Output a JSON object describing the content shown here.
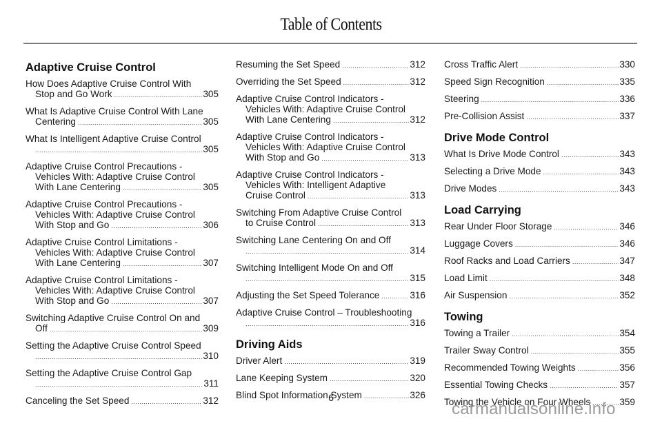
{
  "page": {
    "title": "Table of Contents",
    "page_number": "6",
    "watermark": "carmanualsonline.info"
  },
  "columns": [
    {
      "sections": [
        {
          "heading": "Adaptive Cruise Control",
          "entries": [
            {
              "lines": [
                "How Does Adaptive Cruise Control With",
                "Stop and Go Work"
              ],
              "page": "305"
            },
            {
              "lines": [
                "What Is Adaptive Cruise Control With Lane",
                "Centering"
              ],
              "page": "305"
            },
            {
              "lines": [
                "What Is Intelligent Adaptive Cruise Control",
                ""
              ],
              "page": "305"
            },
            {
              "lines": [
                "Adaptive Cruise Control Precautions -",
                "Vehicles With: Adaptive Cruise Control",
                "With Lane Centering"
              ],
              "page": "305"
            },
            {
              "lines": [
                "Adaptive Cruise Control Precautions -",
                "Vehicles With: Adaptive Cruise Control",
                "With Stop and Go"
              ],
              "page": "306"
            },
            {
              "lines": [
                "Adaptive Cruise Control Limitations -",
                "Vehicles With: Adaptive Cruise Control",
                "With Lane Centering"
              ],
              "page": "307"
            },
            {
              "lines": [
                "Adaptive Cruise Control Limitations -",
                "Vehicles With: Adaptive Cruise Control",
                "With Stop and Go"
              ],
              "page": "307"
            },
            {
              "lines": [
                "Switching Adaptive Cruise Control On and",
                "Off"
              ],
              "page": "309"
            },
            {
              "lines": [
                "Setting the Adaptive Cruise Control Speed",
                ""
              ],
              "page": "310"
            },
            {
              "lines": [
                "Setting the Adaptive Cruise Control Gap",
                ""
              ],
              "page": "311"
            },
            {
              "lines": [
                "Canceling the Set Speed"
              ],
              "page": "312"
            }
          ]
        }
      ]
    },
    {
      "sections": [
        {
          "heading": "",
          "entries": [
            {
              "lines": [
                "Resuming the Set Speed"
              ],
              "page": "312"
            },
            {
              "lines": [
                "Overriding the Set Speed"
              ],
              "page": "312"
            },
            {
              "lines": [
                "Adaptive Cruise Control Indicators -",
                "Vehicles With: Adaptive Cruise Control",
                "With Lane Centering"
              ],
              "page": "312"
            },
            {
              "lines": [
                "Adaptive Cruise Control Indicators -",
                "Vehicles With: Adaptive Cruise Control",
                "With Stop and Go"
              ],
              "page": "313"
            },
            {
              "lines": [
                "Adaptive Cruise Control Indicators -",
                "Vehicles With: Intelligent Adaptive",
                "Cruise Control"
              ],
              "page": "313"
            },
            {
              "lines": [
                "Switching From Adaptive Cruise Control",
                "to Cruise Control"
              ],
              "page": "313"
            },
            {
              "lines": [
                "Switching Lane Centering On and Off",
                ""
              ],
              "page": "314"
            },
            {
              "lines": [
                "Switching Intelligent Mode On and Off",
                ""
              ],
              "page": "315"
            },
            {
              "lines": [
                "Adjusting the Set Speed Tolerance"
              ],
              "page": "316"
            },
            {
              "lines": [
                "Adaptive Cruise Control – Troubleshooting",
                ""
              ],
              "page": "316"
            }
          ]
        },
        {
          "heading": "Driving Aids",
          "entries": [
            {
              "lines": [
                "Driver Alert"
              ],
              "page": "319"
            },
            {
              "lines": [
                "Lane Keeping System"
              ],
              "page": "320"
            },
            {
              "lines": [
                "Blind Spot Information System"
              ],
              "page": "326"
            }
          ]
        }
      ]
    },
    {
      "sections": [
        {
          "heading": "",
          "entries": [
            {
              "lines": [
                "Cross Traffic Alert"
              ],
              "page": "330"
            },
            {
              "lines": [
                "Speed Sign Recognition"
              ],
              "page": "335"
            },
            {
              "lines": [
                "Steering"
              ],
              "page": "336"
            },
            {
              "lines": [
                "Pre-Collision Assist"
              ],
              "page": "337"
            }
          ]
        },
        {
          "heading": "Drive Mode Control",
          "entries": [
            {
              "lines": [
                "What Is Drive Mode Control"
              ],
              "page": "343"
            },
            {
              "lines": [
                "Selecting a Drive Mode"
              ],
              "page": "343"
            },
            {
              "lines": [
                "Drive Modes"
              ],
              "page": "343"
            }
          ]
        },
        {
          "heading": "Load Carrying",
          "entries": [
            {
              "lines": [
                "Rear Under Floor Storage"
              ],
              "page": "346"
            },
            {
              "lines": [
                "Luggage Covers"
              ],
              "page": "346"
            },
            {
              "lines": [
                "Roof Racks and Load Carriers"
              ],
              "page": "347"
            },
            {
              "lines": [
                "Load Limit"
              ],
              "page": "348"
            },
            {
              "lines": [
                "Air Suspension"
              ],
              "page": "352"
            }
          ]
        },
        {
          "heading": "Towing",
          "entries": [
            {
              "lines": [
                "Towing a Trailer"
              ],
              "page": "354"
            },
            {
              "lines": [
                "Trailer Sway Control"
              ],
              "page": "355"
            },
            {
              "lines": [
                "Recommended Towing Weights"
              ],
              "page": "356"
            },
            {
              "lines": [
                "Essential Towing Checks"
              ],
              "page": "357"
            },
            {
              "lines": [
                "Towing the Vehicle on Four Wheels"
              ],
              "page": "359"
            }
          ]
        }
      ]
    }
  ]
}
